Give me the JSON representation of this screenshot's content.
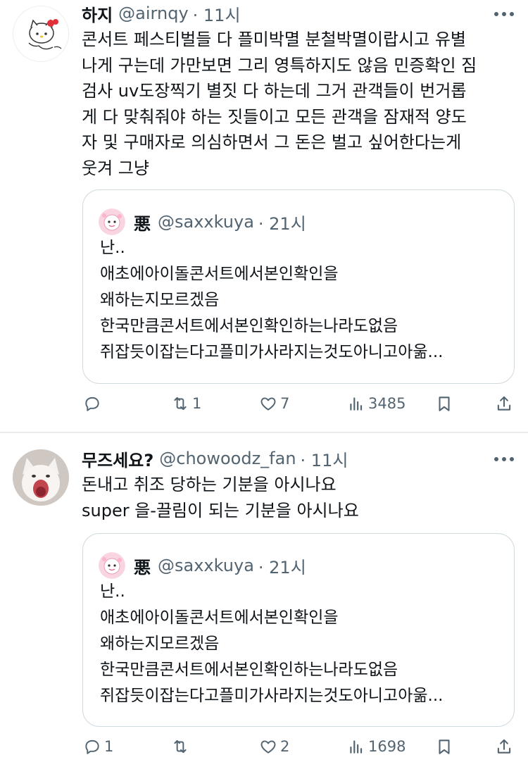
{
  "tweets": [
    {
      "display_name": "하지",
      "handle": "@airnqy",
      "time": "· 11시",
      "lines": [
        "콘서트 페스티벌들 다 플미박멸 분철박멸이랍시고 유별",
        "나게 구는데 가만보면 그리 영특하지도 않음 민증확인 짐",
        "검사 uv도장찍기 별짓 다 하는데 그거 관객들이 번거롭",
        "게 다 맞춰줘야 하는 짓들이고 모든 관객을 잠재적 양도",
        "자 및 구매자로 의심하면서 그 돈은 벌고 싶어한다는게",
        "웃겨 그냥"
      ],
      "quote": {
        "display_name": "悪",
        "handle": "@saxxkuya",
        "time": "· 21시",
        "lines": [
          "난..",
          "애초에아이돌콘서트에서본인확인을",
          "왜하는지모르겠음",
          "한국만큼콘서트에서본인확인하는나라도없음",
          "쥐잡듯이잡는다고플미가사라지는것도아니고아욺..."
        ]
      },
      "actions": {
        "replies": "",
        "retweets": "1",
        "likes": "7",
        "views": "3485"
      }
    },
    {
      "display_name": "무즈세요?",
      "handle": "@chowoodz_fan",
      "time": "· 11시",
      "lines": [
        "돈내고 취조 당하는 기분을 아시나요",
        "super 을-끌림이 되는 기분을 아시나요"
      ],
      "quote": {
        "display_name": "悪",
        "handle": "@saxxkuya",
        "time": "· 21시",
        "lines": [
          "난..",
          "애초에아이돌콘서트에서본인확인을",
          "왜하는지모르겠음",
          "한국만큼콘서트에서본인확인하는나라도없음",
          "쥐잡듯이잡는다고플미가사라지는것도아니고아욺..."
        ]
      },
      "actions": {
        "replies": "1",
        "retweets": "",
        "likes": "2",
        "views": "1698"
      }
    }
  ],
  "colors": {
    "text": "#0f1419",
    "secondary": "#536471",
    "border": "#cfd9de"
  }
}
